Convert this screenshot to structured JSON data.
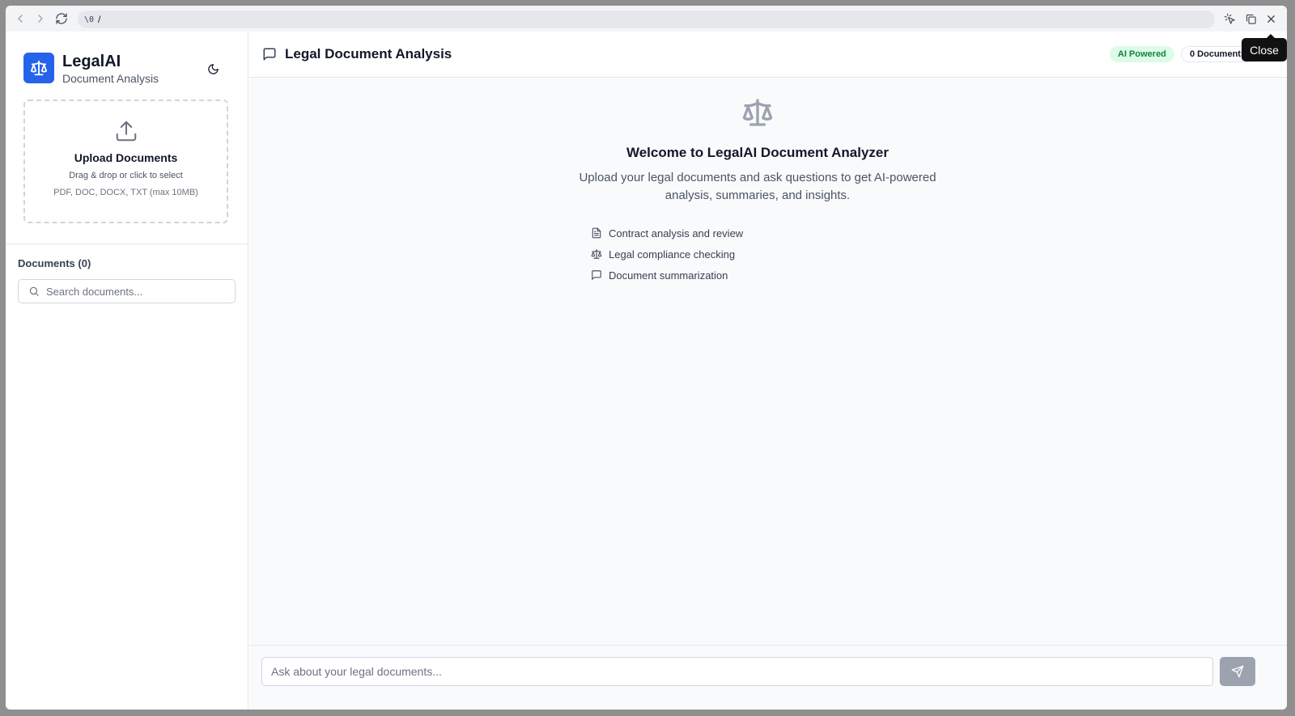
{
  "browser": {
    "url_prefix": "\\0",
    "url_path": "/",
    "tooltip": "Close"
  },
  "sidebar": {
    "brand_name": "LegalAI",
    "brand_subtitle": "Document Analysis",
    "upload": {
      "title": "Upload Documents",
      "hint": "Drag & drop or click to select",
      "types": "PDF, DOC, DOCX, TXT (max 10MB)"
    },
    "documents_title": "Documents (0)",
    "search_placeholder": "Search documents..."
  },
  "main": {
    "title": "Legal Document Analysis",
    "badge_ai": "AI Powered",
    "badge_docs": "0 Documents",
    "welcome_title": "Welcome to LegalAI Document Analyzer",
    "welcome_desc": "Upload your legal documents and ask questions to get AI-powered analysis, summaries, and insights.",
    "features": [
      {
        "label": "Contract analysis and review",
        "icon": "file-text-icon"
      },
      {
        "label": "Legal compliance checking",
        "icon": "scale-icon"
      },
      {
        "label": "Document summarization",
        "icon": "message-square-icon"
      }
    ],
    "composer_placeholder": "Ask about your legal documents..."
  },
  "colors": {
    "accent": "#2563eb",
    "badge_green_bg": "#dcfce7",
    "badge_green_text": "#15803d",
    "send_button": "#9ca3af"
  }
}
